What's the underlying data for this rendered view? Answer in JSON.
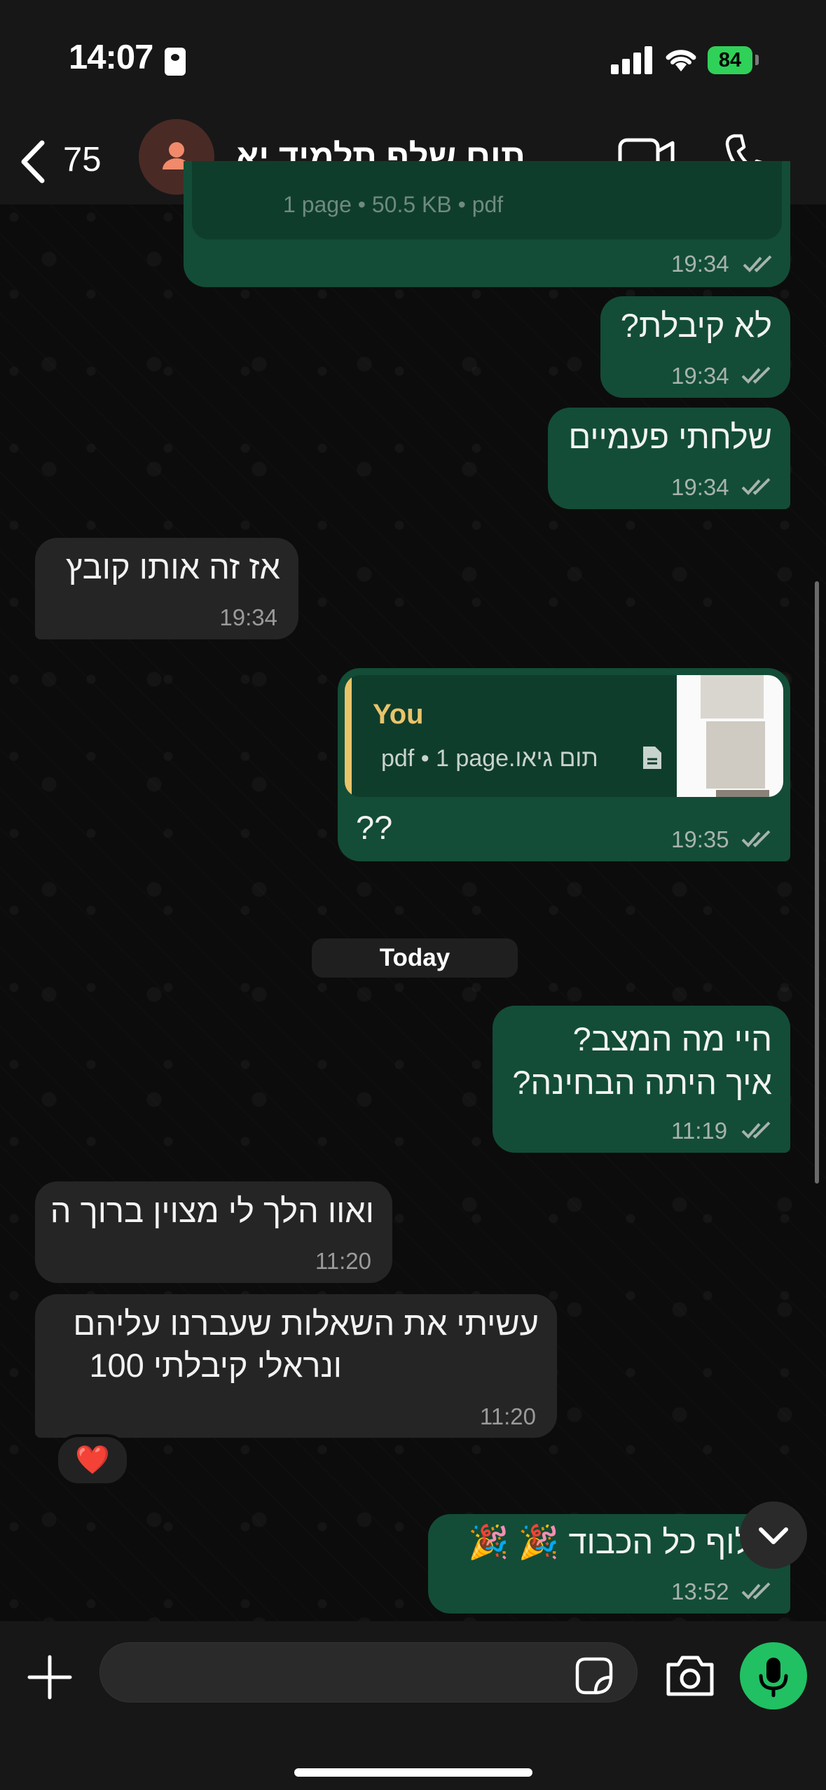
{
  "status_bar": {
    "time": "14:07",
    "battery": "84"
  },
  "header": {
    "back_count": "75",
    "contact_name": "תום שלף תלמיד יא"
  },
  "messages": [
    {
      "text": "",
      "time": "19:34",
      "note": ""
    },
    {
      "text": "לא קיבלת?",
      "time": "19:34"
    },
    {
      "text": "שלחתי פעמיים",
      "time": "19:34"
    },
    {
      "text": "אז זה אותו קובץ",
      "time": "19:34"
    },
    {
      "reply_author": "You",
      "reply_file": "pdf • 1 page.תום  גיאו",
      "text": "??",
      "time": "19:35"
    },
    {
      "line1": "היי מה המצב?",
      "line2": "איך היתה הבחינה?",
      "time": "11:19"
    },
    {
      "text": "ואוו הלך לי מצוין ברוך ה",
      "time": "11:20"
    },
    {
      "line1": "עשיתי את השאלות שעברנו עליהם",
      "line2": "ונראלי קיבלתי 100",
      "time": "11:20",
      "reaction": "❤️"
    },
    {
      "text": "אלוף כל הכבוד 🎉 🎉",
      "time": "13:52"
    }
  ],
  "date_separator": "Today",
  "top_partial_text": "1 page • 50.5 KB • pdf",
  "colors": {
    "outgoing": "#134d37",
    "incoming": "#252525",
    "accent": "#21c063",
    "reply_author": "#e9c46a"
  }
}
